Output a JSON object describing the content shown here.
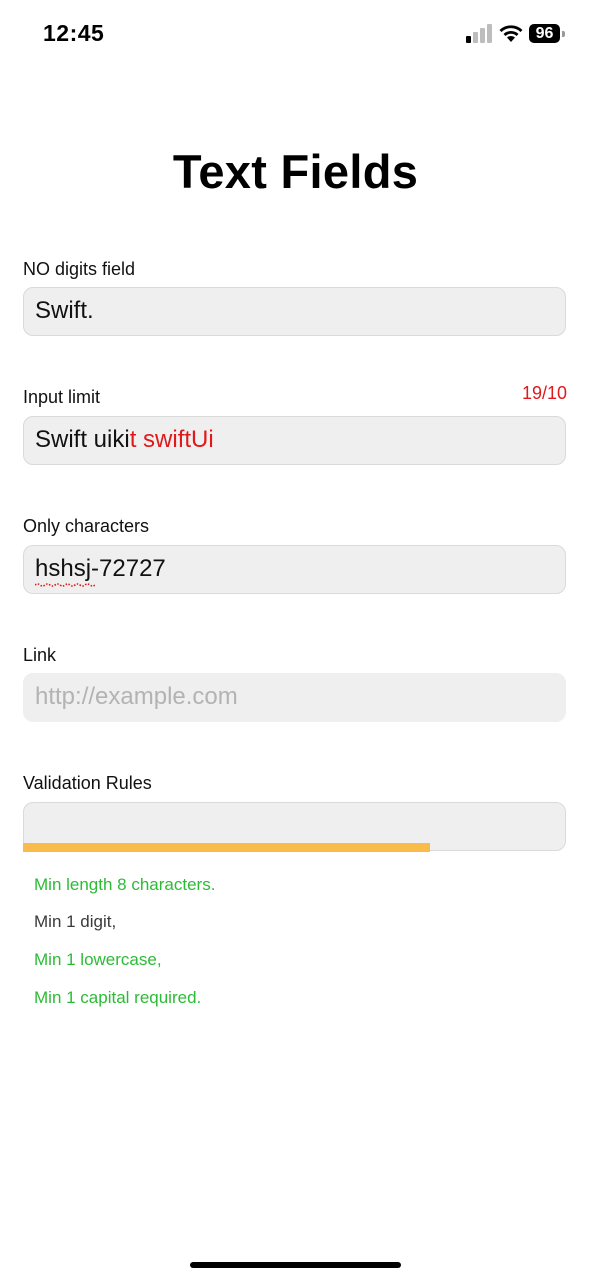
{
  "status_bar": {
    "time": "12:45",
    "battery": "96",
    "icons": [
      "signal-icon",
      "wifi-icon",
      "battery-icon"
    ]
  },
  "title": "Text Fields",
  "fields": {
    "no_digits": {
      "label": "NO digits field",
      "value": "Swift."
    },
    "input_limit": {
      "label": "Input limit",
      "counter": "19/10",
      "value_within": "Swift uiki",
      "value_over": "t swiftUi"
    },
    "only_characters": {
      "label": "Only characters",
      "value": "hshsj-72727"
    },
    "link": {
      "label": "Link",
      "placeholder": "http://example.com"
    },
    "validation": {
      "label": "Validation Rules",
      "value": "",
      "strength_fraction": 0.75,
      "strength_color": "#f9bc4a"
    }
  },
  "rules": [
    {
      "text": "Min length 8 characters.",
      "status": "ok"
    },
    {
      "text": "Min 1 digit,",
      "status": "pending"
    },
    {
      "text": "Min 1 lowercase,",
      "status": "ok"
    },
    {
      "text": "Min 1 capital required.",
      "status": "ok"
    }
  ],
  "colors": {
    "ok": "#2dbb37",
    "error": "#e0191b",
    "field_background": "#efefef"
  }
}
